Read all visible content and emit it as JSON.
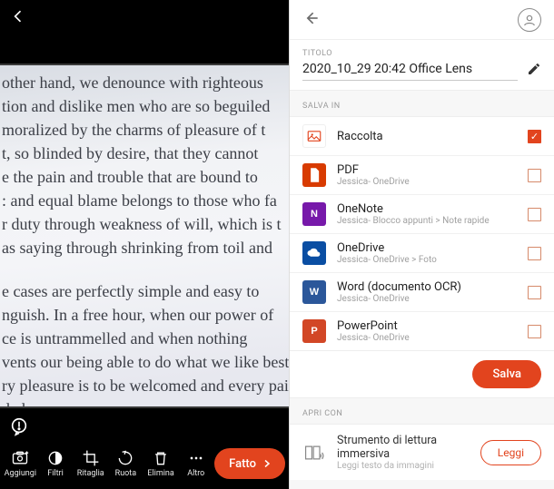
{
  "left": {
    "document_text": {
      "p1": [
        "other hand, we denounce with righteous",
        "tion and dislike men who are so beguiled",
        "moralized by the charms of pleasure of t",
        "t, so blinded by desire, that they cannot",
        "e the pain and trouble that are bound to",
        ": and equal blame belongs to those who fa",
        "r duty through weakness of will, which is t",
        "as saying through shrinking from toil and"
      ],
      "p2": [
        "e cases are perfectly simple and easy to",
        "nguish. In a free hour, when our power of",
        "ce is untrammelled and when nothing",
        "vents our being able to do what we like best,",
        "ry pleasure is to be welcomed and every pain",
        "ded."
      ]
    },
    "tools": {
      "add": "Aggiungi",
      "filters": "Filtri",
      "crop": "Ritaglia",
      "rotate": "Ruota",
      "delete": "Elimina",
      "more": "Altro"
    },
    "done": "Fatto"
  },
  "right": {
    "title_label": "TITOLO",
    "title_value": "2020_10_29 20:42 Office Lens",
    "save_label": "SALVA IN",
    "options": [
      {
        "key": "raccolta",
        "name": "Raccolta",
        "sub": "",
        "checked": true
      },
      {
        "key": "pdf",
        "name": "PDF",
        "sub": "Jessica- OneDrive",
        "checked": false
      },
      {
        "key": "onenote",
        "name": "OneNote",
        "sub": "Jessica- Blocco appunti > Note rapide",
        "checked": false
      },
      {
        "key": "onedrive",
        "name": "OneDrive",
        "sub": "Jessica- OneDrive > Foto",
        "checked": false
      },
      {
        "key": "word",
        "name": "Word (documento OCR)",
        "sub": "Jessica- OneDrive",
        "checked": false
      },
      {
        "key": "ppt",
        "name": "PowerPoint",
        "sub": "Jessica- OneDrive",
        "checked": false
      }
    ],
    "save_button": "Salva",
    "open_label": "APRI CON",
    "open_with": {
      "name": "Strumento di lettura immersiva",
      "sub": "Leggi testo da immagini"
    },
    "read_button": "Leggi"
  }
}
